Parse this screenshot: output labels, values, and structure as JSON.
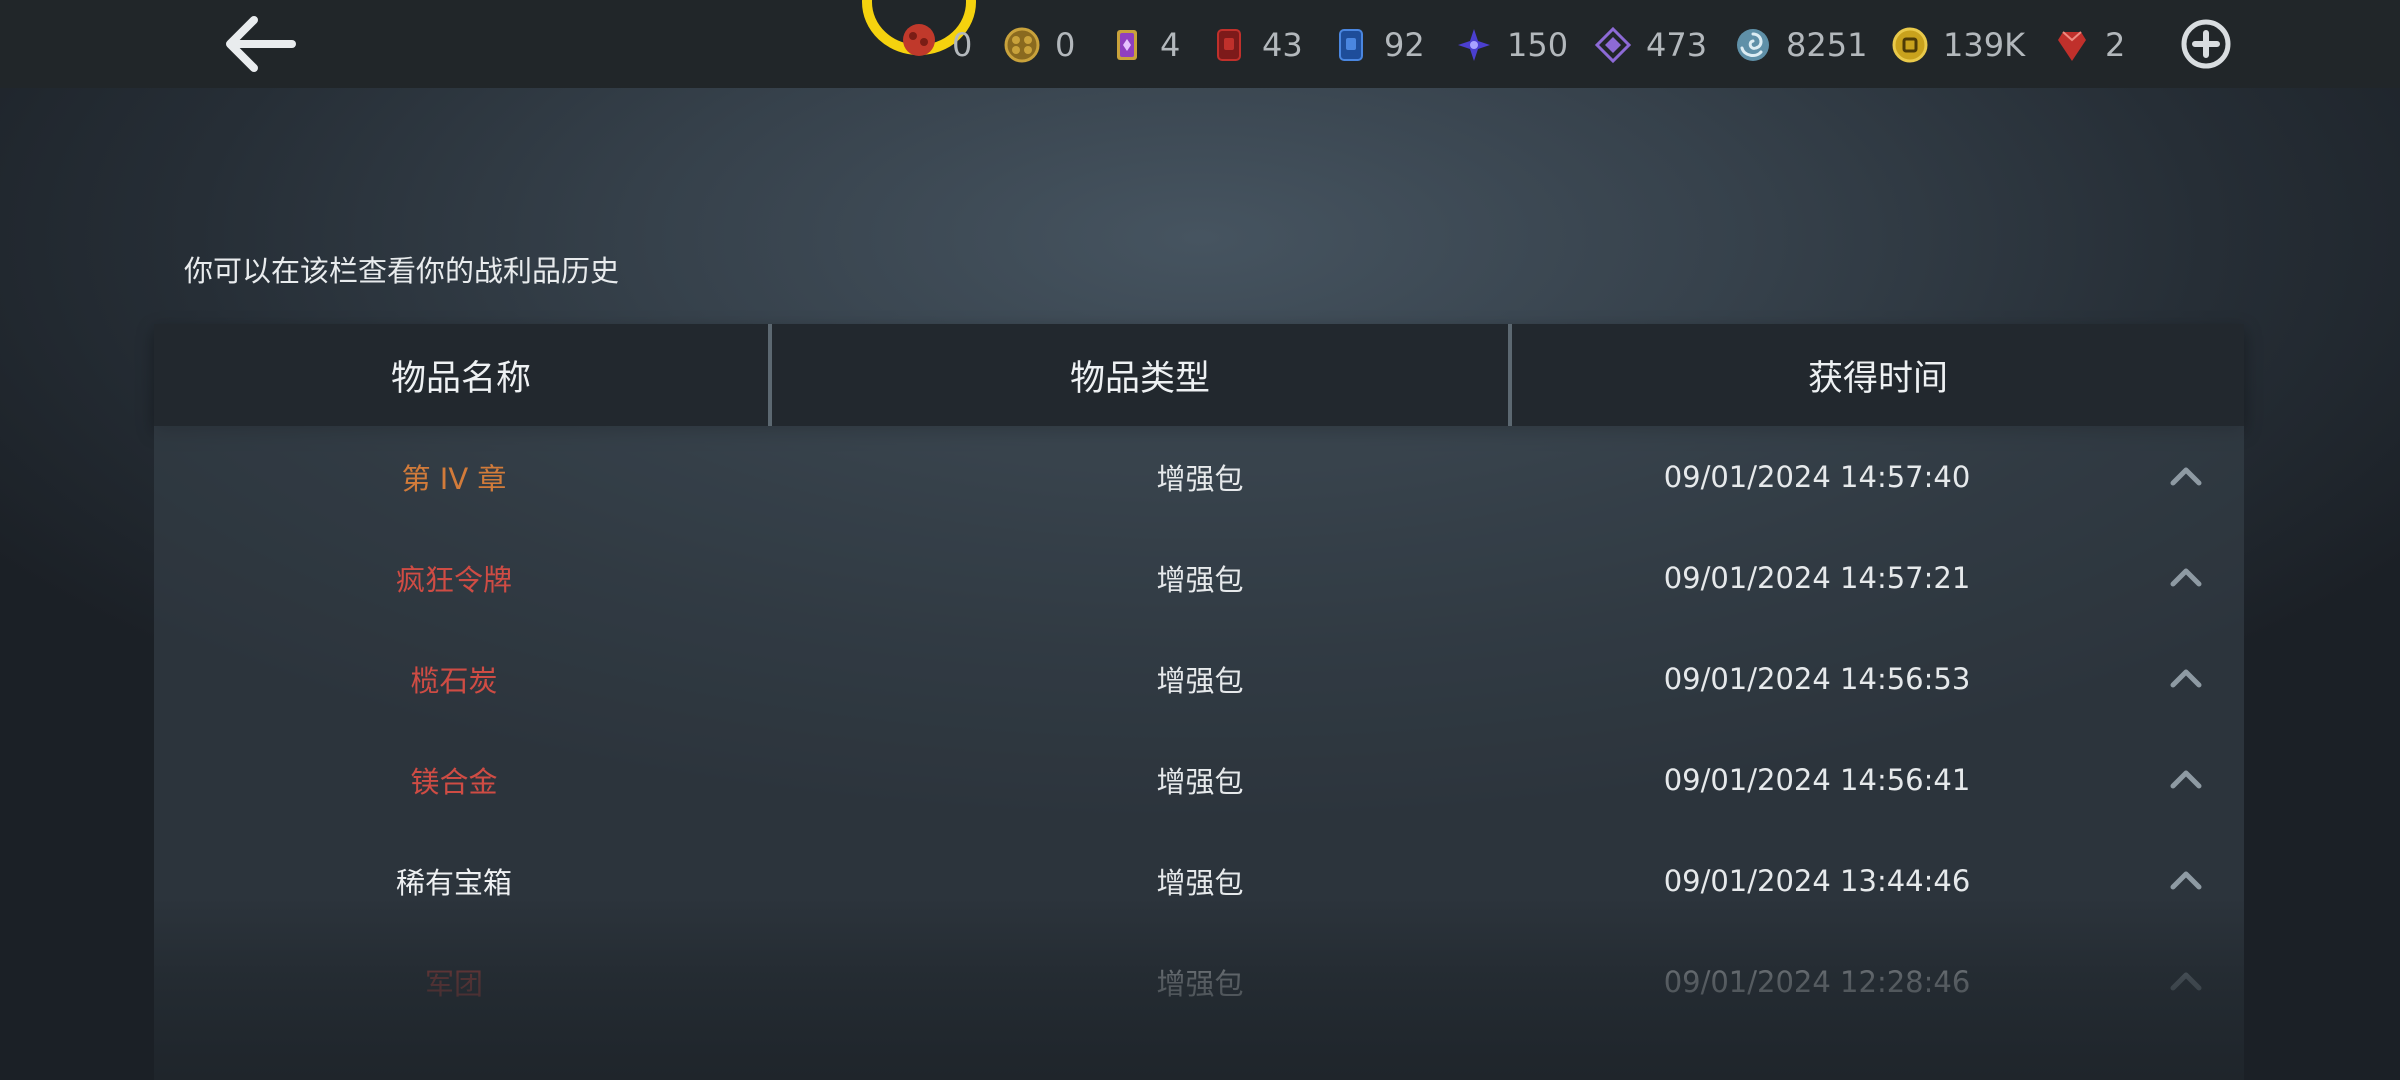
{
  "topbar": {
    "currencies": [
      {
        "icon": "fire-orb-icon",
        "value": "0"
      },
      {
        "icon": "bronze-coin-icon",
        "value": "0"
      },
      {
        "icon": "purple-ticket-icon",
        "value": "4"
      },
      {
        "icon": "red-card-icon",
        "value": "43"
      },
      {
        "icon": "blue-card-icon",
        "value": "92"
      },
      {
        "icon": "blue-star-icon",
        "value": "150"
      },
      {
        "icon": "purple-diamond-icon",
        "value": "473"
      },
      {
        "icon": "swirl-icon",
        "value": "8251"
      },
      {
        "icon": "gold-coin-icon",
        "value": "139K"
      },
      {
        "icon": "red-gem-icon",
        "value": "2"
      }
    ]
  },
  "subtitle": "你可以在该栏查看你的战利品历史",
  "table": {
    "headers": [
      "物品名称",
      "物品类型",
      "获得时间"
    ],
    "rows": [
      {
        "name": "第 IV 章",
        "type": "增强包",
        "time": "09/01/2024 14:57:40",
        "name_color": "#d27b3a"
      },
      {
        "name": "疯狂令牌",
        "type": "增强包",
        "time": "09/01/2024 14:57:21",
        "name_color": "#cf4c44"
      },
      {
        "name": "榄石炭",
        "type": "增强包",
        "time": "09/01/2024 14:56:53",
        "name_color": "#cf4c44"
      },
      {
        "name": "镁合金",
        "type": "增强包",
        "time": "09/01/2024 14:56:41",
        "name_color": "#cf4c44"
      },
      {
        "name": "稀有宝箱",
        "type": "增强包",
        "time": "09/01/2024 13:44:46",
        "name_color": "#eef0f2"
      },
      {
        "name": "军团",
        "type": "增强包",
        "time": "09/01/2024 12:28:46",
        "name_color": "#cf4c44"
      }
    ]
  },
  "colors": {
    "accent_orange": "#d27b3a",
    "accent_red": "#cf4c44",
    "emblem_gold": "#f5d20e"
  }
}
